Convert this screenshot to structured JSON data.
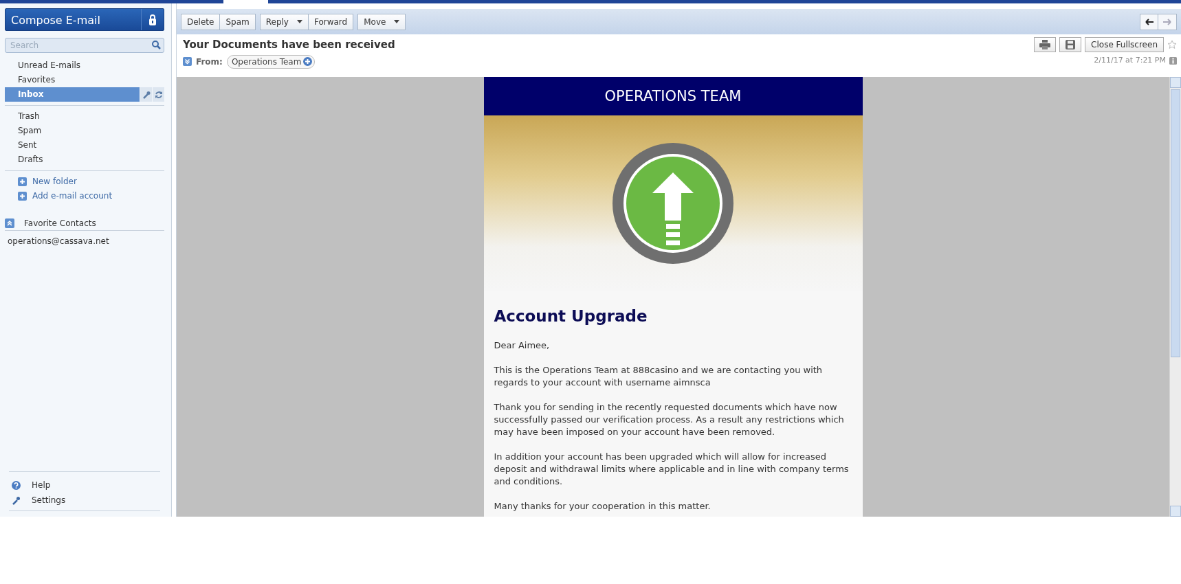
{
  "compose": {
    "label": "Compose E-mail"
  },
  "search": {
    "placeholder": "Search"
  },
  "smart_folders": [
    {
      "label": "Unread E-mails",
      "selected": false
    },
    {
      "label": "Favorites",
      "selected": false
    },
    {
      "label": "Inbox",
      "selected": true
    }
  ],
  "mail_folders": [
    {
      "label": "Trash",
      "selected": false
    },
    {
      "label": "Spam",
      "selected": false
    },
    {
      "label": "Sent",
      "selected": false
    },
    {
      "label": "Drafts",
      "selected": false
    }
  ],
  "folder_actions": [
    "New folder",
    "Add e-mail account"
  ],
  "favorite_contacts": {
    "title": "Favorite Contacts",
    "contacts": [
      "operations@cassava.net"
    ]
  },
  "footer_links": [
    {
      "label": "Help",
      "kind": "help"
    },
    {
      "label": "Settings",
      "kind": "settings"
    }
  ],
  "toolbar": [
    [
      {
        "label": "Delete",
        "dropdown": false
      },
      {
        "label": "Spam",
        "dropdown": false
      }
    ],
    [
      {
        "label": "Reply",
        "dropdown": true
      },
      {
        "label": "Forward",
        "dropdown": false
      }
    ],
    [
      {
        "label": "Move",
        "dropdown": true
      }
    ]
  ],
  "message": {
    "subject": "Your Documents have been received",
    "from_label": "From:",
    "sender": "Operations Team",
    "date": "2/11/17 at 7:21 PM",
    "close_button": "Close Fullscreen",
    "starred": false
  },
  "email": {
    "banner": "OPERATIONS TEAM",
    "heading": "Account Upgrade",
    "paragraphs": [
      "Dear Aimee,",
      "This is the Operations Team at 888casino and we are contacting you with regards to your account with username aimnsca",
      "Thank you for sending in the recently requested documents which have now successfully passed our verification process. As a result any restrictions which may have been imposed on your account have been removed.",
      "In addition your account has been upgraded which will allow for increased deposit and withdrawal limits where applicable and in line with company terms and conditions.",
      "Many thanks for your cooperation in this matter."
    ]
  }
}
